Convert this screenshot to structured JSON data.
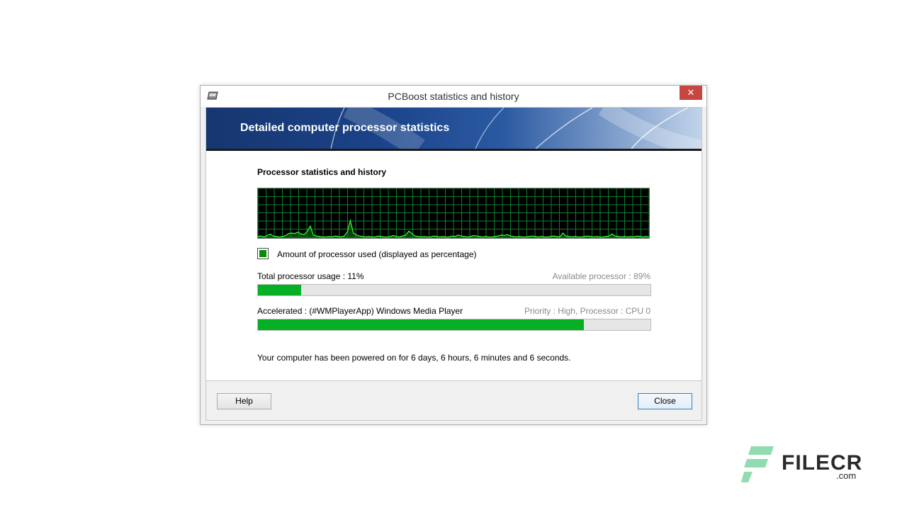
{
  "window": {
    "title": "PCBoost statistics and history",
    "close_glyph": "✕",
    "icon": "pcboost-app-icon"
  },
  "banner": {
    "title": "Detailed computer processor statistics"
  },
  "stats": {
    "section_title": "Processor statistics and history",
    "legend_label": "Amount of processor used (displayed as percentage)",
    "legend_color": "#0a8a0a",
    "graph_line_color": "#39ff39",
    "graph_grid_color": "#0f7f2a",
    "cpu_history_percent": [
      3,
      4,
      2,
      5,
      8,
      4,
      3,
      2,
      3,
      5,
      9,
      10,
      9,
      12,
      8,
      7,
      13,
      24,
      6,
      4,
      3,
      2,
      2,
      3,
      2,
      4,
      3,
      2,
      4,
      12,
      35,
      10,
      6,
      4,
      3,
      2,
      3,
      2,
      2,
      4,
      3,
      2,
      2,
      3,
      5,
      3,
      2,
      4,
      6,
      14,
      9,
      4,
      3,
      2,
      3,
      2,
      2,
      4,
      3,
      2,
      3,
      2,
      2,
      4,
      3,
      6,
      4,
      3,
      2,
      3,
      5,
      4,
      3,
      2,
      3,
      2,
      2,
      3,
      4,
      6,
      5,
      7,
      4,
      3,
      2,
      3,
      2,
      2,
      3,
      4,
      3,
      2,
      3,
      2,
      2,
      3,
      4,
      3,
      2,
      10,
      4,
      3,
      2,
      3,
      2,
      2,
      3,
      4,
      3,
      2,
      3,
      2,
      2,
      3,
      4,
      8,
      4,
      3,
      2,
      3,
      2,
      3,
      2,
      4,
      3,
      2,
      3,
      2
    ],
    "total_usage_label": "Total processor usage : 11%",
    "total_usage_percent": 11,
    "available_label": "Available processor : 89%",
    "accelerated_label": "Accelerated : (#WMPlayerApp) Windows Media Player",
    "priority_label": "Priority : High, Processor : CPU 0",
    "accelerated_bar_percent": 83,
    "bar_color": "#06b025",
    "uptime_text": "Your computer has been powered on for 6 days, 6 hours, 6 minutes and 6 seconds."
  },
  "buttons": {
    "help": "Help",
    "close": "Close"
  },
  "watermark": {
    "brand": "FILECR",
    "suffix": ".com",
    "logo": "filecr-logo-icon"
  }
}
